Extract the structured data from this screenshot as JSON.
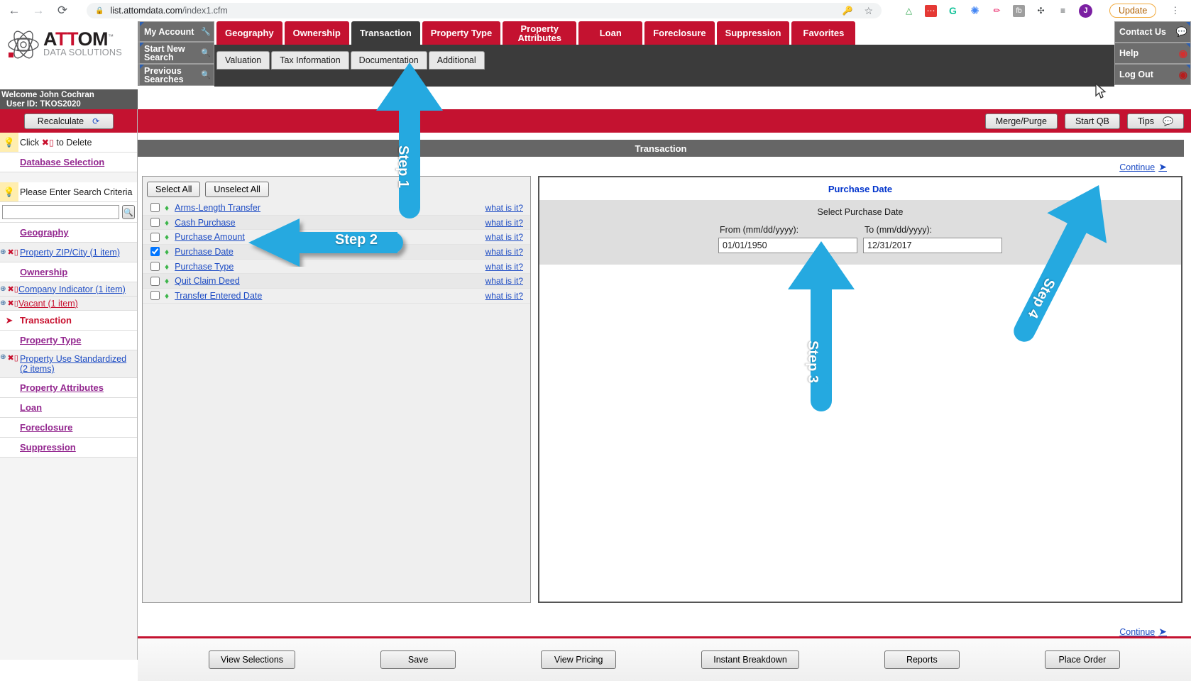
{
  "browser": {
    "back_icon": "back-arrow-icon",
    "forward_icon": "forward-arrow-icon",
    "reload_icon": "reload-icon",
    "lock_icon": "lock-icon",
    "url_host": "list.attomdata.com",
    "url_path": "/index1.cfm",
    "key_icon": "password-key-icon",
    "star_icon": "bookmark-star-icon",
    "extensions": [
      "drive-icon",
      "red-box-icon",
      "grammarly-icon",
      "asterisk-icon",
      "pen-icon",
      "fb-icon",
      "puzzle-icon",
      "list-icon"
    ],
    "profile_initial": "J",
    "update_label": "Update",
    "menu_icon": "kebab-menu-icon"
  },
  "logo": {
    "name_a": "A",
    "name_tt": "TT",
    "name_om": "OM",
    "tm": "™",
    "subtitle": "DATA SOLUTIONS"
  },
  "account": {
    "welcome": "Welcome John Cochran",
    "user_id": "User ID: TKOS2020",
    "items": [
      {
        "label": "My Account",
        "icon": "wrench-icon"
      },
      {
        "label": "Start New Search",
        "icon": "magnifier-icon"
      },
      {
        "label": "Previous Searches",
        "icon": "green-magnifier-icon"
      }
    ]
  },
  "right_menu": [
    {
      "label": "Contact Us",
      "icon": "speech-bubbles-icon"
    },
    {
      "label": "Help",
      "icon": "lifering-icon"
    },
    {
      "label": "Log Out",
      "icon": "logout-icon"
    }
  ],
  "main_tabs": [
    {
      "label": "Geography",
      "active": false
    },
    {
      "label": "Ownership",
      "active": false
    },
    {
      "label": "Transaction",
      "active": true
    },
    {
      "label": "Property Type",
      "active": false
    },
    {
      "label": "Property Attributes",
      "active": false
    },
    {
      "label": "Loan",
      "active": false
    },
    {
      "label": "Foreclosure",
      "active": false
    },
    {
      "label": "Suppression",
      "active": false
    },
    {
      "label": "Favorites",
      "active": false
    }
  ],
  "sub_tabs": [
    {
      "label": "Valuation"
    },
    {
      "label": "Tax Information"
    },
    {
      "label": "Documentation"
    },
    {
      "label": "Additional"
    }
  ],
  "action_bar": {
    "merge_purge": "Merge/Purge",
    "start_qb": "Start QB",
    "tips": "Tips",
    "tips_icon": "tip-bubble-icon"
  },
  "sidebar": {
    "recalculate": "Recalculate",
    "recalculate_icon": "refresh-icon",
    "delete_hint_pre": "Click",
    "delete_hint_post": "to Delete",
    "delete_icon": "delete-x-icon",
    "database_selection": "Database Selection",
    "criteria_hint": "Please Enter Search Criteria",
    "search_value": "",
    "search_placeholder": "",
    "search_icon": "magnifier-icon",
    "bulb_icon": "lightbulb-icon",
    "groups": [
      {
        "label": "Geography",
        "type": "header",
        "style": "purple"
      },
      {
        "label": "Property ZIP/City (1 item)",
        "type": "item",
        "style": "blue"
      },
      {
        "label": "Ownership",
        "type": "header",
        "style": "purple"
      },
      {
        "label": "Company Indicator (1 item)",
        "type": "item",
        "style": "blue"
      },
      {
        "label": "Vacant (1 item)",
        "type": "item",
        "style": "red"
      },
      {
        "label": "Transaction",
        "type": "header",
        "style": "current"
      },
      {
        "label": "Property Type",
        "type": "header",
        "style": "purple"
      },
      {
        "label": "Property Use Standardized (2 items)",
        "type": "item",
        "style": "blue"
      },
      {
        "label": "Property Attributes",
        "type": "header",
        "style": "purple"
      },
      {
        "label": "Loan",
        "type": "header",
        "style": "purple"
      },
      {
        "label": "Foreclosure",
        "type": "header",
        "style": "purple"
      },
      {
        "label": "Suppression",
        "type": "header",
        "style": "purple"
      }
    ]
  },
  "content": {
    "header": "Transaction",
    "continue_top": "Continue",
    "continue_bottom": "Continue",
    "continue_arrow_icon": "right-arrow-icon",
    "select_all": "Select All",
    "unselect_all": "Unselect All",
    "what_is_it": "what is it?",
    "puzzle_icon": "puzzle-piece-icon",
    "options": [
      {
        "label": "Arms-Length Transfer",
        "checked": false
      },
      {
        "label": "Cash Purchase",
        "checked": false
      },
      {
        "label": "Purchase Amount",
        "checked": false
      },
      {
        "label": "Purchase Date",
        "checked": true
      },
      {
        "label": "Purchase Type",
        "checked": false
      },
      {
        "label": "Quit Claim Deed",
        "checked": false
      },
      {
        "label": "Transfer Entered Date",
        "checked": false
      }
    ]
  },
  "detail_panel": {
    "title": "Purchase Date",
    "subtitle": "Select Purchase Date",
    "from_label": "From (mm/dd/yyyy):",
    "from_value": "01/01/1950",
    "to_label": "To (mm/dd/yyyy):",
    "to_value": "12/31/2017"
  },
  "bottom_buttons": [
    {
      "label": "View Selections"
    },
    {
      "label": "Save"
    },
    {
      "label": "View Pricing"
    },
    {
      "label": "Instant Breakdown"
    },
    {
      "label": "Reports"
    },
    {
      "label": "Place Order"
    }
  ],
  "annotations": {
    "color": "#25a9e0",
    "steps": [
      {
        "label": "Step 1"
      },
      {
        "label": "Step 2"
      },
      {
        "label": "Step 3"
      },
      {
        "label": "Step 4"
      }
    ]
  }
}
